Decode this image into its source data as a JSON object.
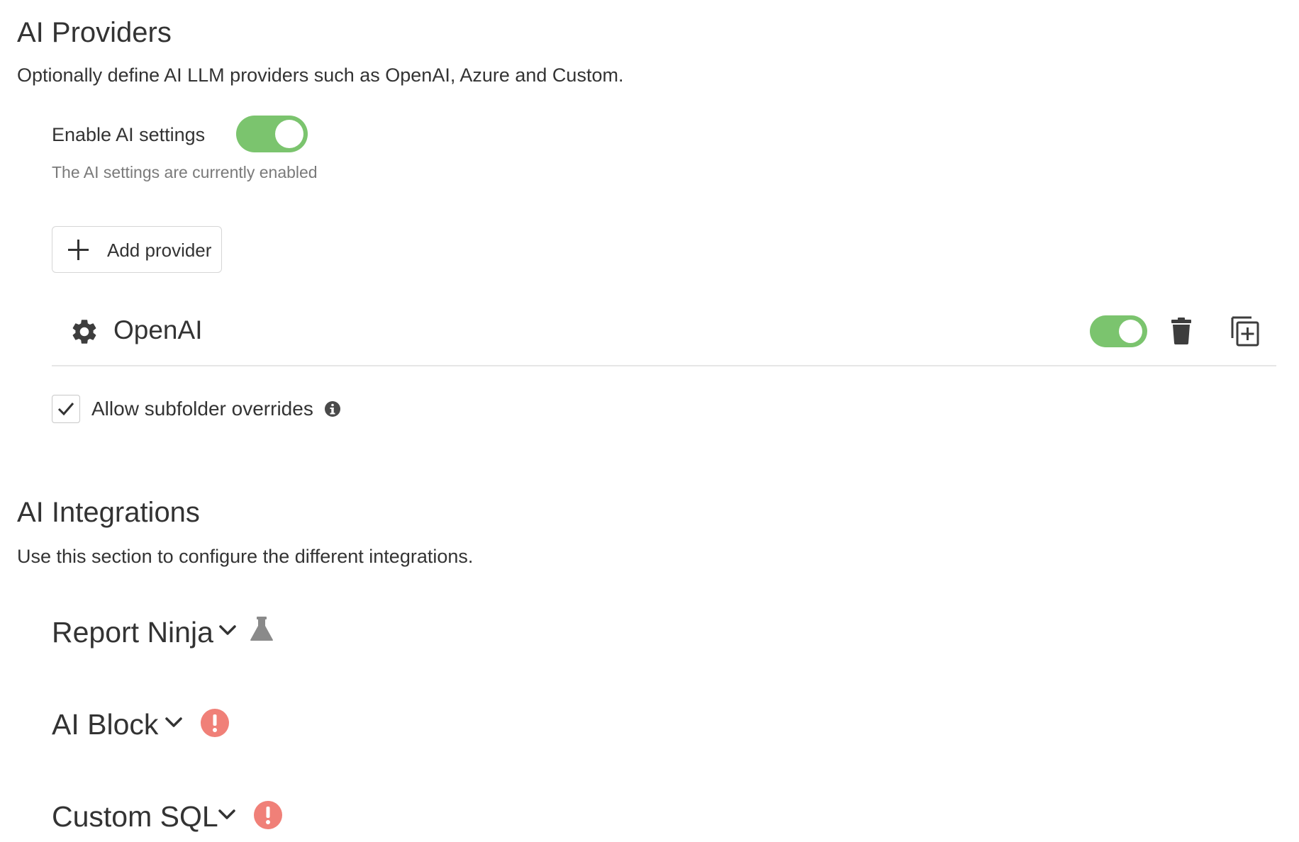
{
  "providers_section": {
    "title": "AI Providers",
    "description": "Optionally define AI LLM providers such as OpenAI, Azure and Custom.",
    "enable_label": "Enable AI settings",
    "enable_hint": "The AI settings are currently enabled",
    "enabled": true,
    "add_provider_label": "Add provider",
    "providers": [
      {
        "name": "OpenAI",
        "enabled": true
      }
    ],
    "allow_subfolder_label": "Allow subfolder overrides",
    "allow_subfolder_checked": true
  },
  "integrations_section": {
    "title": "AI Integrations",
    "description": "Use this section to configure the different integrations.",
    "items": [
      {
        "name": "Report Ninja",
        "status_icon": "flask-icon"
      },
      {
        "name": "AI Block",
        "status_icon": "alert-icon"
      },
      {
        "name": "Custom SQL",
        "status_icon": "alert-icon"
      }
    ]
  },
  "colors": {
    "toggle_on": "#7bc46e",
    "alert": "#f08078",
    "text": "#333333",
    "muted_text": "#7a7a7a",
    "icon_dark": "#3d3d3d",
    "flask_gray": "#8a8a8a"
  }
}
